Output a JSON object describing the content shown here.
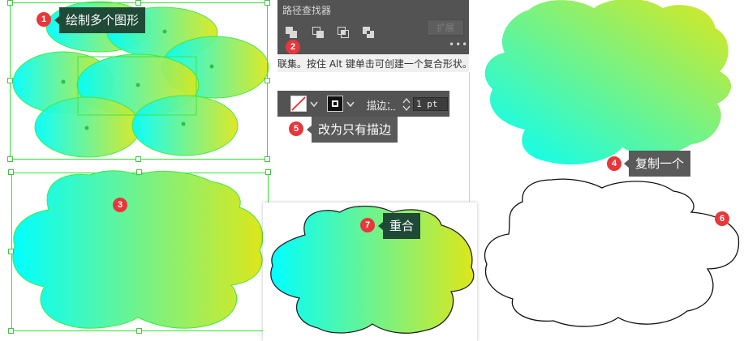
{
  "colors": {
    "gradient_start": "#00ffff",
    "gradient_end": "#dde71a",
    "selection": "#2ee62e",
    "badge": "#e8373a",
    "callout_dark": "#1f4a38",
    "callout_gray": "#5a5a5a",
    "panel_bg": "#535353"
  },
  "steps": [
    {
      "number": "1",
      "label": "绘制多个图形"
    },
    {
      "number": "2",
      "label": ""
    },
    {
      "number": "3",
      "label": ""
    },
    {
      "number": "4",
      "label": "复制一个"
    },
    {
      "number": "5",
      "label": "改为只有描边"
    },
    {
      "number": "6",
      "label": ""
    },
    {
      "number": "7",
      "label": "重合"
    }
  ],
  "pathfinder": {
    "title": "路径查找器",
    "expand_label": "扩展",
    "more_label": "•••",
    "tooltip": "联集。按住 Alt 键单击可创建一个复合形状。",
    "buttons": [
      {
        "icon": "unite-icon"
      },
      {
        "icon": "minus-front-icon"
      },
      {
        "icon": "intersect-icon"
      },
      {
        "icon": "exclude-icon"
      }
    ]
  },
  "controlbar": {
    "fill_icon": "fill-none-icon",
    "stroke_icon": "stroke-swatch-icon",
    "stroke_label": "描边：",
    "stroke_value": "1 pt"
  }
}
